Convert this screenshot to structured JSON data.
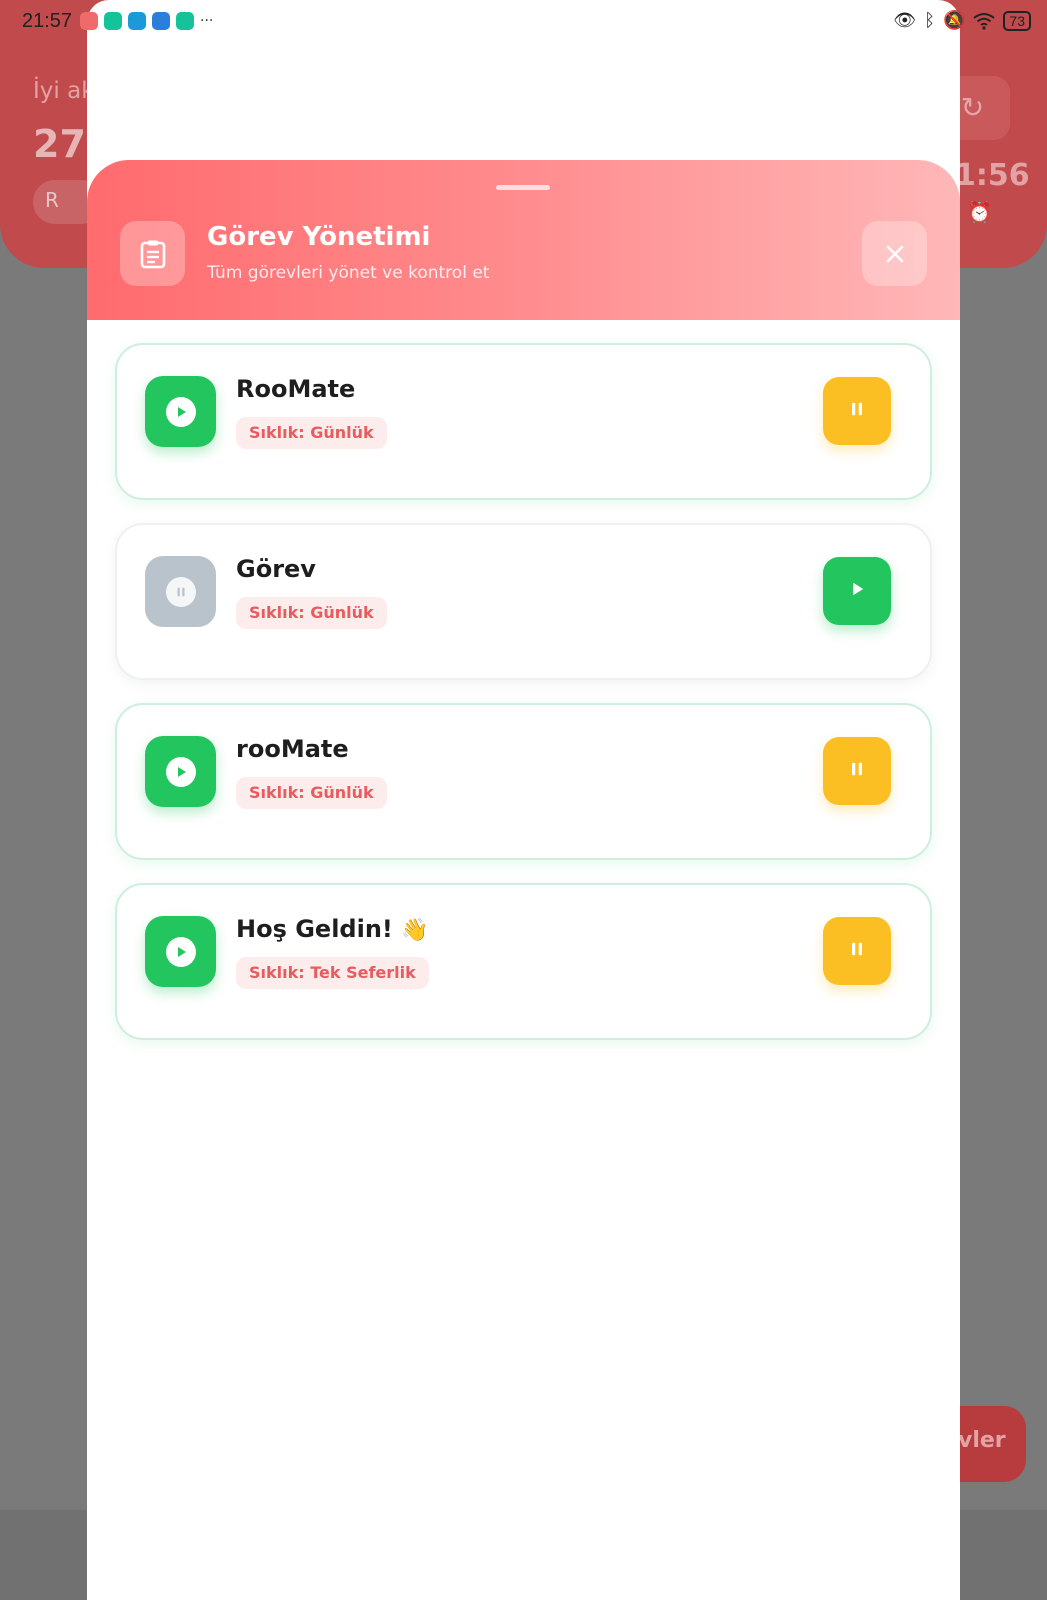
{
  "status_bar": {
    "time": "21:57",
    "battery": "73",
    "app_icons": [
      {
        "icon": "notification-app-icon",
        "color": "#ef6b6b"
      },
      {
        "icon": "grammarly-icon",
        "color": "#15c39a"
      },
      {
        "icon": "notification-app-icon",
        "color": "#1a9bd8"
      },
      {
        "icon": "notification-app-icon",
        "color": "#2b7fd9"
      },
      {
        "icon": "grammarly-icon",
        "color": "#15c39a"
      }
    ],
    "more": "···"
  },
  "background": {
    "greeting": "İyi ak",
    "big_number": "27",
    "chip_label": "R",
    "time": "1:56",
    "fab_label": "vler"
  },
  "modal": {
    "title": "Görev Yönetimi",
    "subtitle": "Tüm görevleri yönet ve kontrol et",
    "header_icon": "clipboard-icon",
    "close_icon": "close-icon"
  },
  "tasks": [
    {
      "title": "RooMate",
      "frequency": "Sıklık: Günlük",
      "active": true,
      "action": "pause"
    },
    {
      "title": "Görev",
      "frequency": "Sıklık: Günlük",
      "active": false,
      "action": "play"
    },
    {
      "title": "rooMate",
      "frequency": "Sıklık: Günlük",
      "active": true,
      "action": "pause"
    },
    {
      "title": "Hoş Geldin!",
      "emoji": "👋",
      "frequency": "Sıklık: Tek Seferlik",
      "active": true,
      "action": "pause"
    }
  ],
  "colors": {
    "header_gradient_start": "#ff6b6e",
    "header_gradient_end": "#ffb7b8",
    "active_green": "#22c55e",
    "pause_yellow": "#fbbf24",
    "inactive_gray": "#b9c3cc",
    "badge_bg": "#fdecec",
    "badge_text": "#e85b5e"
  }
}
